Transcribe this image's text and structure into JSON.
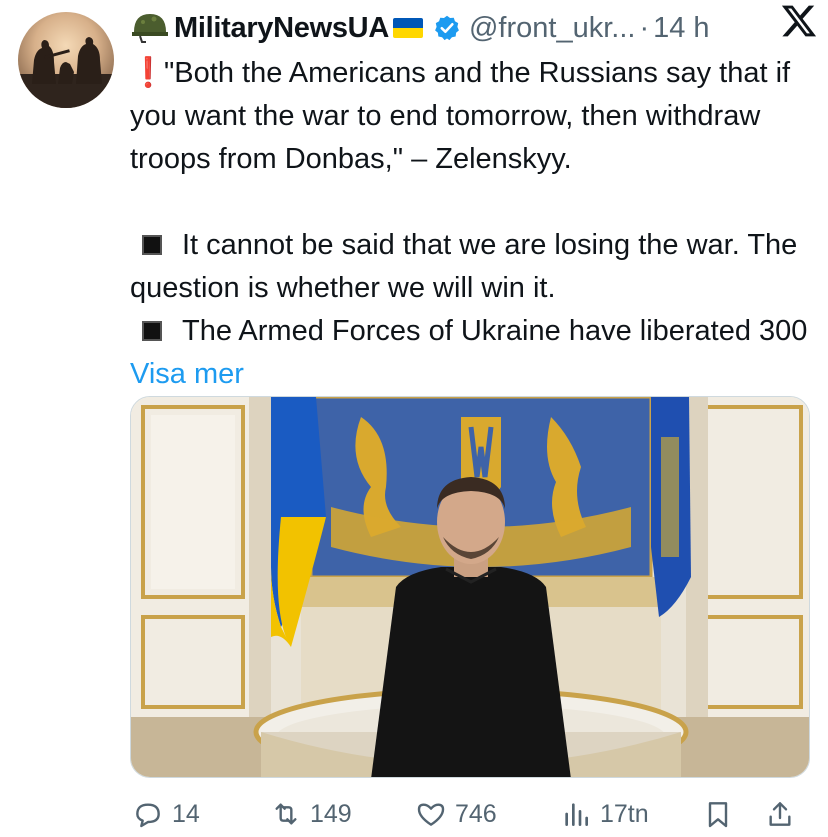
{
  "tweet": {
    "author_name": "MilitaryNewsUA",
    "author_handle": "@front_ukr...",
    "separator": "·",
    "time": "14 h",
    "paragraph1": "\"Both the Americans and the Russians say that if you want the war to end tomorrow, then withdraw troops from Donbas,\" – Zelenskyy.",
    "bullet1": "It cannot be said that we are losing the war. The question is whether we will win it.",
    "bullet2": "The Armed Forces of Ukraine have liberated 300",
    "show_more": "Visa mer"
  },
  "actions": {
    "replies": "14",
    "reposts": "149",
    "likes": "746",
    "views": "17tn"
  },
  "icons": {
    "helmet": "military-helmet-emoji",
    "exclamation": "red-exclamation-emoji",
    "bullet": "black-square-emoji",
    "verified": "verified-badge-icon",
    "platform": "x-logo-icon"
  },
  "colors": {
    "link": "#1d9bf0",
    "muted": "#536471",
    "verified": "#1d9bf0",
    "flag_blue": "#0057b7",
    "flag_yellow": "#ffd700"
  }
}
